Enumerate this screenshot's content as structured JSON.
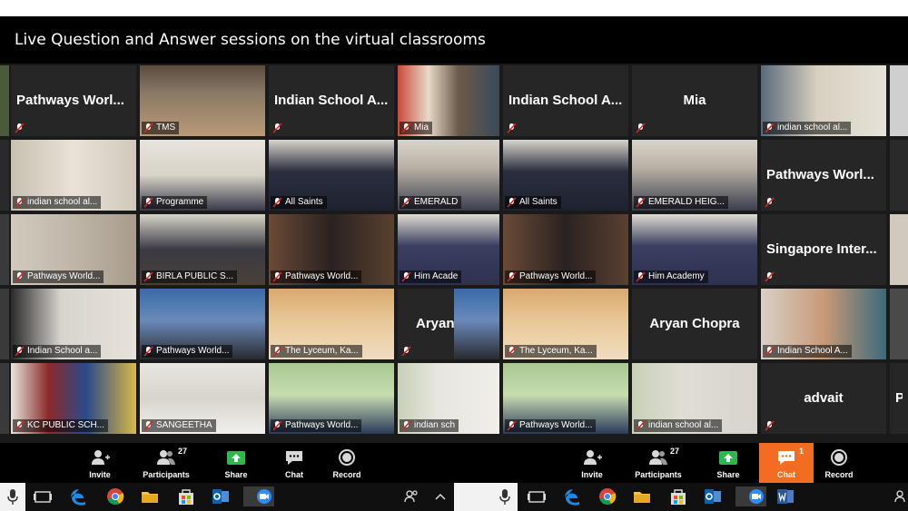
{
  "banner": {
    "title": "Live Question and Answer sessions on the virtual classrooms"
  },
  "tiles": {
    "r1c1": "Pathways  Worl...",
    "r1c2": "TMS",
    "r1c3": "Indian School A...",
    "r1c4": "Mia",
    "r1c5": "Indian School A...",
    "r1c6": "Mia",
    "r1c7": "indian school al...",
    "r2c1": "indian school al...",
    "r2c2": "Programme",
    "r2c3": "All Saints",
    "r2c4": "EMERALD",
    "r2c5": "All Saints",
    "r2c6": "EMERALD HEIG...",
    "r2c7": "Pathways  Worl...",
    "r3c1": "Pathways World...",
    "r3c2": "BIRLA PUBLIC S...",
    "r3c3": "Pathways World...",
    "r3c4": "Him Acade",
    "r3c5": "Pathways World...",
    "r3c6": "Him Academy",
    "r3c7": "Singapore  Inter...",
    "r4c1": "Indian School a...",
    "r4c2": "Pathways World...",
    "r4c3": "The Lyceum, Ka...",
    "r4c4": "Aryan",
    "r4c5": "The Lyceum, Ka...",
    "r4c6": "Aryan Chopra",
    "r4c7": "Indian School A...",
    "r5c1": "KC PUBLIC SCH...",
    "r5c2": "SANGEETHA",
    "r5c3": "Pathways World...",
    "r5c4": "indian sch",
    "r5c5": "Pathways World...",
    "r5c6": "indian school al...",
    "r5c7": "advait",
    "r5c8": "Pa"
  },
  "toolbar_left": {
    "invite": "Invite",
    "participants": "Participants",
    "participants_count": "27",
    "share": "Share",
    "chat": "Chat",
    "record": "Record"
  },
  "toolbar_right": {
    "invite": "Invite",
    "participants": "Participants",
    "participants_count": "27",
    "share": "Share",
    "chat": "Chat",
    "chat_count": "1",
    "record": "Record"
  },
  "colors": {
    "share_green": "#2db84d",
    "chat_active": "#f26d21",
    "mic_muted": "#e02424"
  }
}
